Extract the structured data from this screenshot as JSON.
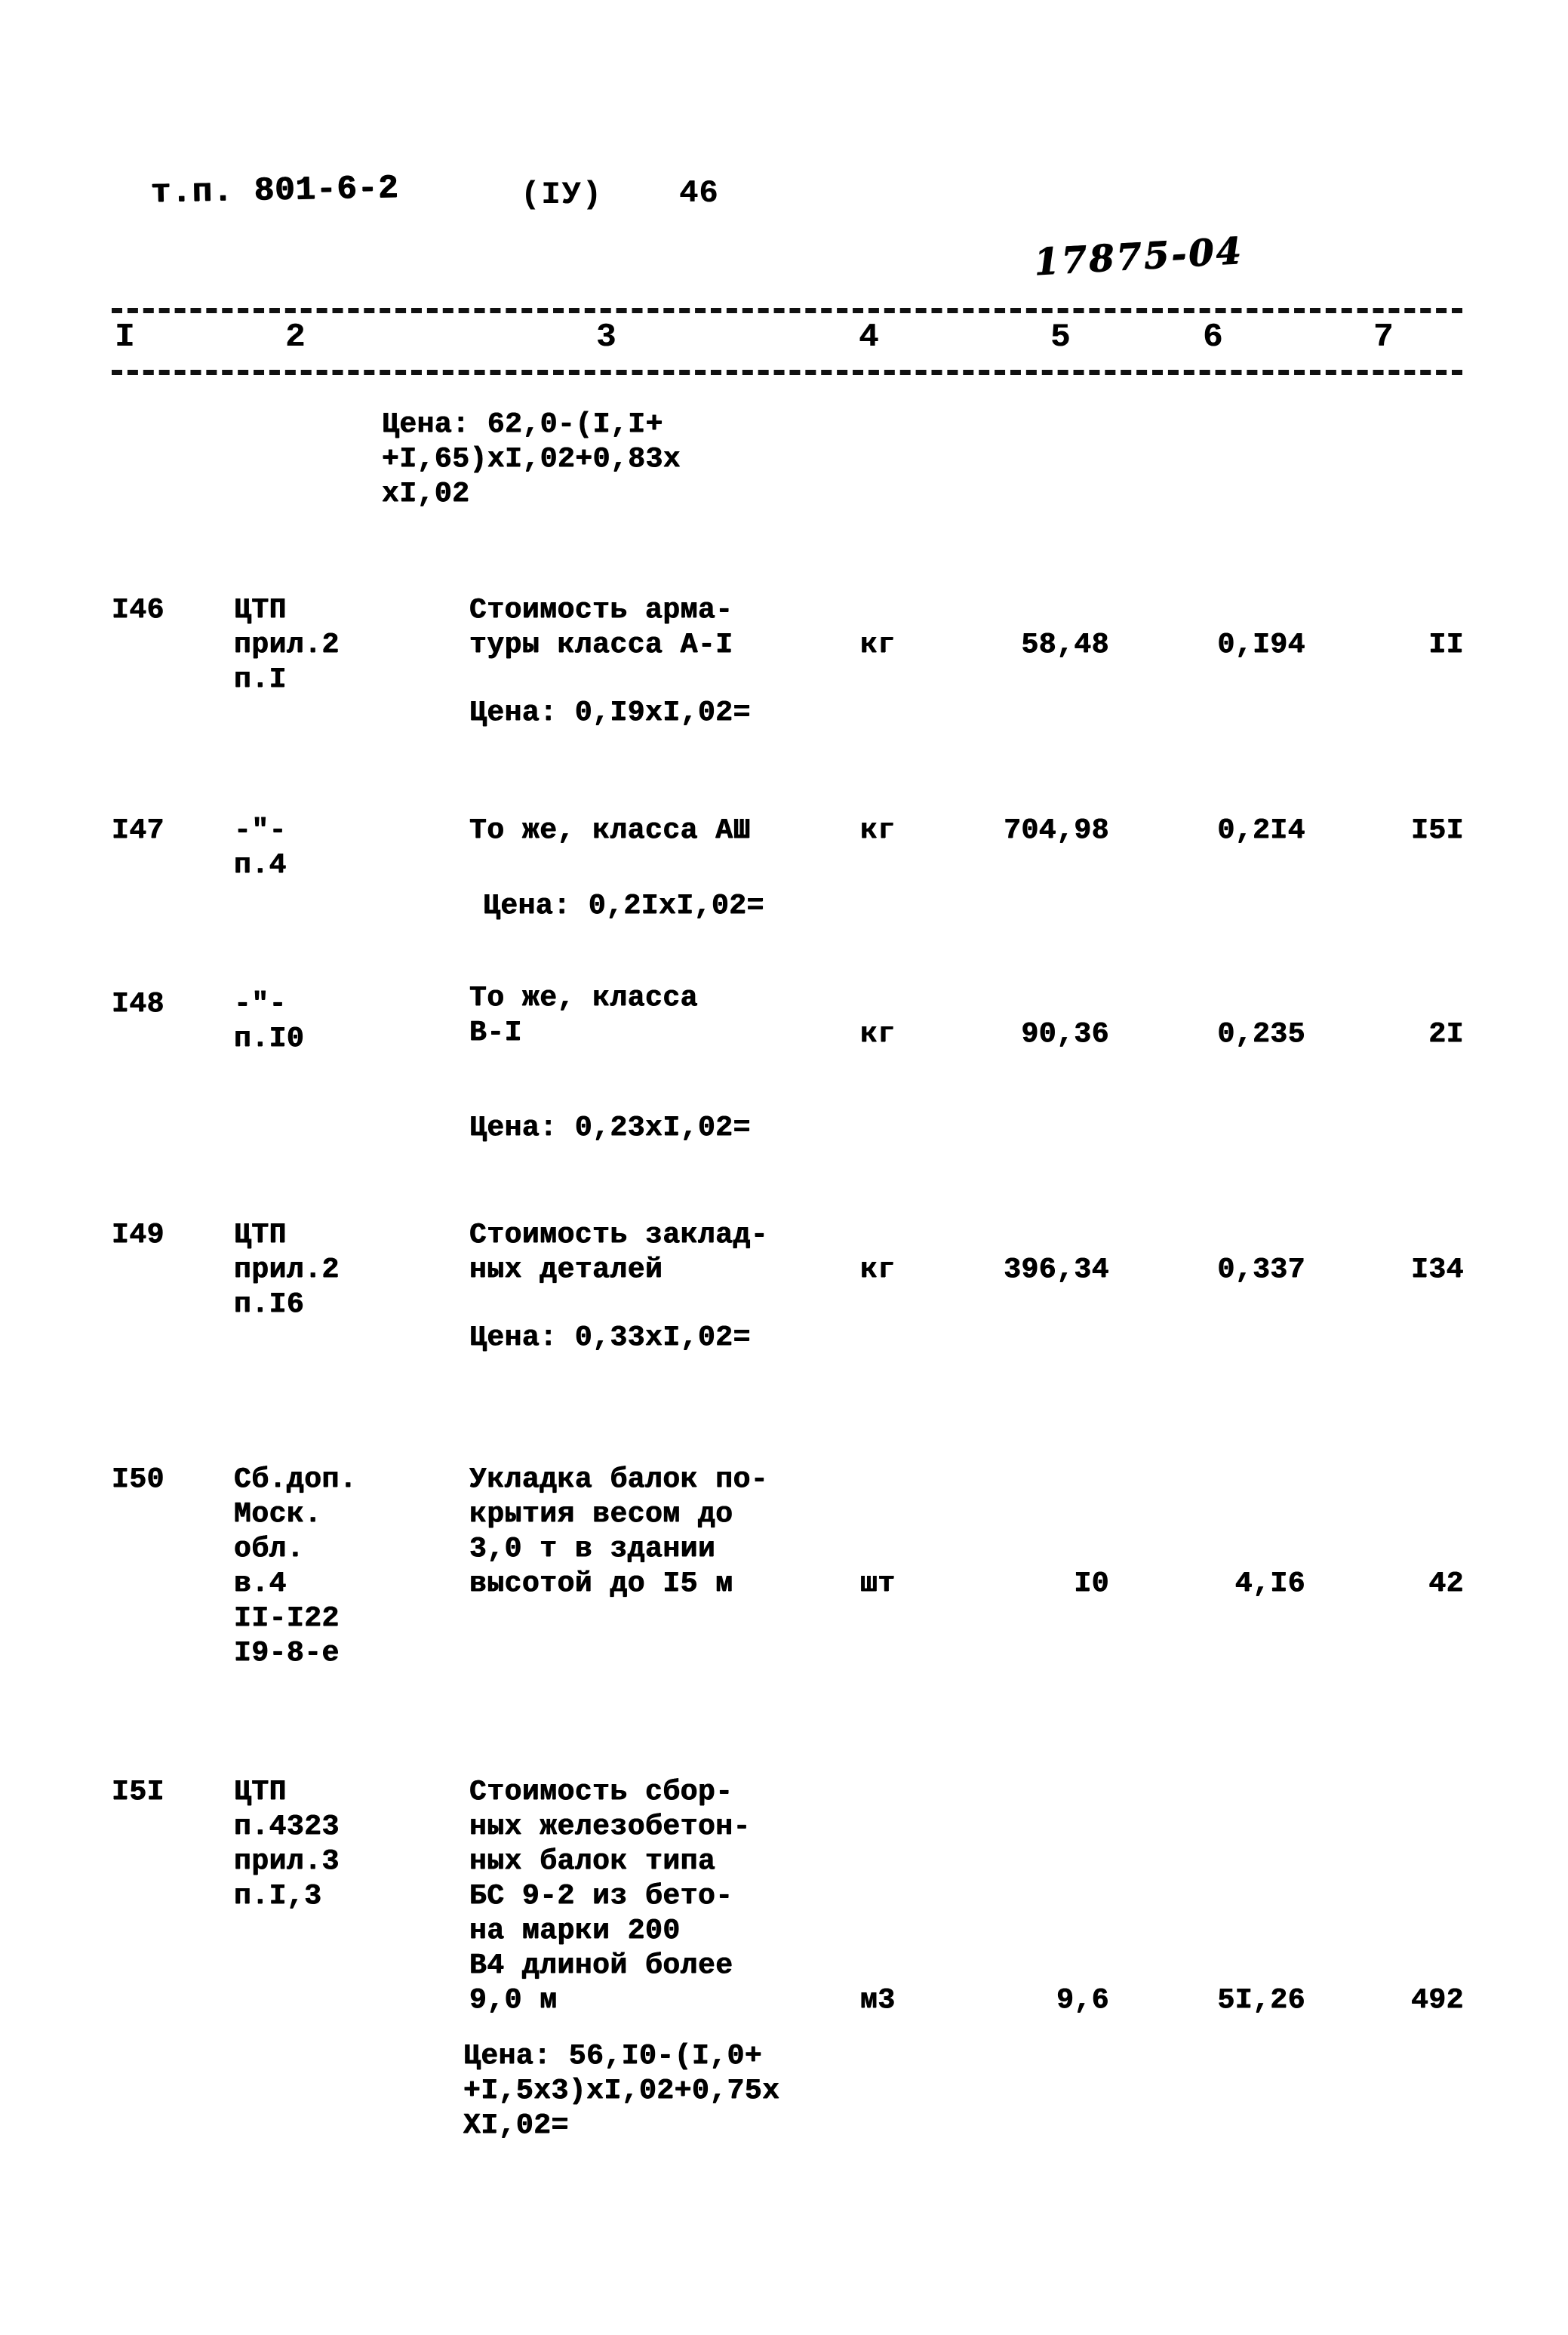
{
  "header": {
    "doc_code": "т.п. 801-6-2",
    "part": "(IУ)",
    "page_number": "46",
    "archive_number": "17875-04"
  },
  "table": {
    "column_numbers": [
      "I",
      "2",
      "3",
      "4",
      "5",
      "6",
      "7"
    ],
    "top_note": "Цена: 62,0-(I,I+\n+I,65)xI,02+0,83x\nxI,02",
    "rows": [
      {
        "no": "I46",
        "ref": "ЦТП\nприл.2\nп.I",
        "description": "Стоимость арма-\nтуры класса А-I",
        "unit": "кг",
        "qty": "58,48",
        "unit_price": "0,I94",
        "total": "II",
        "price_note": "Цена: 0,I9xI,02="
      },
      {
        "no": "I47",
        "ref": "-\"-\nп.4",
        "description": "То же, класса АШ",
        "unit": "кг",
        "qty": "704,98",
        "unit_price": "0,2I4",
        "total": "I5I",
        "price_note": "Цена: 0,2IxI,02="
      },
      {
        "no": "I48",
        "ref": "-\"-\nп.I0",
        "description": "То же, класса\nВ-I",
        "unit": "кг",
        "qty": "90,36",
        "unit_price": "0,235",
        "total": "2I",
        "price_note": "Цена: 0,23xI,02="
      },
      {
        "no": "I49",
        "ref": "ЦТП\nприл.2\nп.I6",
        "description": "Стоимость заклад-\nных деталей",
        "unit": "кг",
        "qty": "396,34",
        "unit_price": "0,337",
        "total": "I34",
        "price_note": "Цена: 0,33xI,02="
      },
      {
        "no": "I50",
        "ref": "Сб.доп.\nМоск.\nобл.\nв.4\nII-I22\nI9-8-е",
        "description": "Укладка балок по-\nкрытия весом до\n3,0 т в здании\nвысотой до I5 м",
        "unit": "шт",
        "qty": "I0",
        "unit_price": "4,I6",
        "total": "42",
        "price_note": ""
      },
      {
        "no": "I5I",
        "ref": "ЦТП\nп.4323\nприл.3\nп.I,3",
        "description": "Стоимость сбор-\nных железобетон-\nных балок типа\nБС 9-2 из бето-\nна марки 200\nВ4 длиной более\n9,0 м",
        "unit": "м3",
        "qty": "9,6",
        "unit_price": "5I,26",
        "total": "492",
        "price_note": "Цена: 56,I0-(I,0+\n+I,5x3)xI,02+0,75x\nXI,02="
      }
    ]
  }
}
